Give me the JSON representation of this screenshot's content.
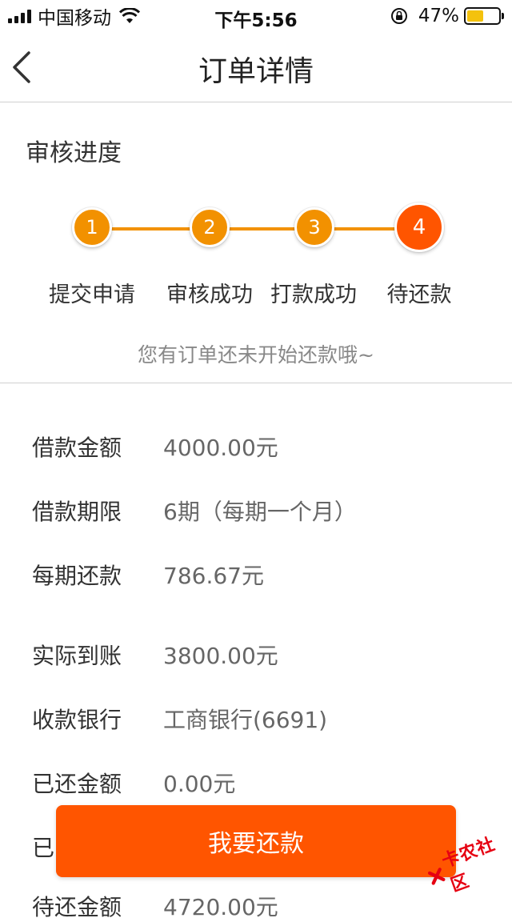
{
  "status_bar": {
    "carrier": "中国移动",
    "time": "下午5:56",
    "battery_percent": "47%",
    "battery_level": 0.47,
    "icons": [
      "signal-icon",
      "wifi-icon",
      "rotation-lock-icon",
      "battery-icon"
    ]
  },
  "nav": {
    "title": "订单详情",
    "back_icon": "chevron-left-icon"
  },
  "progress": {
    "section_title": "审核进度",
    "steps": [
      {
        "number": "1",
        "label": "提交申请"
      },
      {
        "number": "2",
        "label": "审核成功"
      },
      {
        "number": "3",
        "label": "打款成功"
      },
      {
        "number": "4",
        "label": "待还款"
      }
    ],
    "current_step": 4,
    "hint": "您有订单还未开始还款哦~"
  },
  "details": [
    {
      "label": "借款金额",
      "value": "4000.00元"
    },
    {
      "label": "借款期限",
      "value": "6期（每期一个月）"
    },
    {
      "label": "每期还款",
      "value": "786.67元"
    },
    {
      "label": "实际到账",
      "value": "3800.00元"
    },
    {
      "label": "收款银行",
      "value": "工商银行(6691)"
    },
    {
      "label": "已还金额",
      "value": "0.00元"
    },
    {
      "label": "已",
      "value": ""
    },
    {
      "label": "待还金额",
      "value": "4720.00元"
    }
  ],
  "button": {
    "label": "我要还款"
  },
  "watermark": {
    "text": "卡农社区"
  },
  "colors": {
    "accent": "#ff5500",
    "step": "#f29100",
    "battery": "#f4c20d"
  }
}
